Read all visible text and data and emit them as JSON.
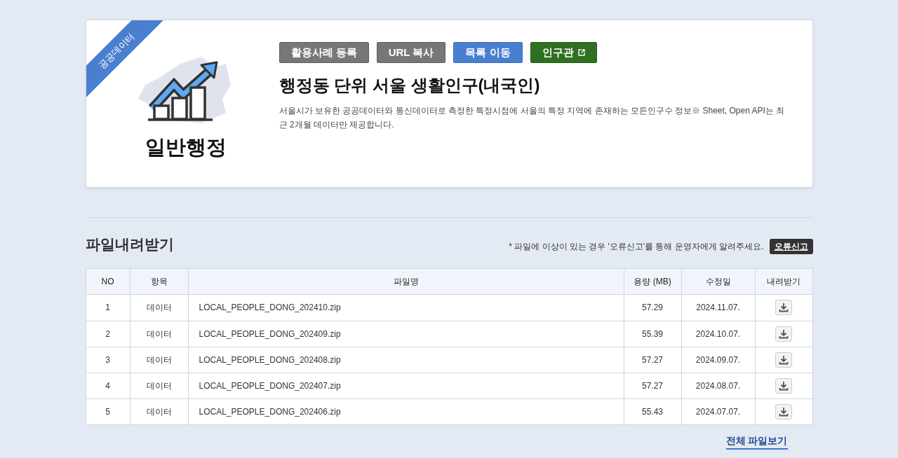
{
  "dataset": {
    "ribbon": "공공데이터",
    "category": "일반행정",
    "buttons": [
      {
        "label": "활용사례 등록",
        "kind": "gray"
      },
      {
        "label": "URL 복사",
        "kind": "gray"
      },
      {
        "label": "목록 이동",
        "kind": "blue"
      },
      {
        "label": "인구관",
        "kind": "external"
      }
    ],
    "title": "행정동 단위 서울 생활인구(내국인)",
    "description": "서울시가 보유한 공공데이터와 통신데이터로 측정한 특정시점에 서울의 특정 지역에 존재하는 모든인구수 정보※ Sheet, Open API는 최근 2개월 데이터만 제공합니다."
  },
  "downloads": {
    "title": "파일내려받기",
    "notice": "* 파일에 이상이 있는 경우 '오류신고'를 통해 운영자에게 알려주세요.",
    "report_button": "오류신고",
    "columns": [
      "NO",
      "항목",
      "파일명",
      "용량 (MB)",
      "수정일",
      "내려받기"
    ],
    "rows": [
      {
        "no": "1",
        "type": "데이터",
        "file": "LOCAL_PEOPLE_DONG_202410.zip",
        "size": "57.29",
        "date": "2024.11.07."
      },
      {
        "no": "2",
        "type": "데이터",
        "file": "LOCAL_PEOPLE_DONG_202409.zip",
        "size": "55.39",
        "date": "2024.10.07."
      },
      {
        "no": "3",
        "type": "데이터",
        "file": "LOCAL_PEOPLE_DONG_202408.zip",
        "size": "57.27",
        "date": "2024.09.07."
      },
      {
        "no": "4",
        "type": "데이터",
        "file": "LOCAL_PEOPLE_DONG_202407.zip",
        "size": "57.27",
        "date": "2024.08.07."
      },
      {
        "no": "5",
        "type": "데이터",
        "file": "LOCAL_PEOPLE_DONG_202406.zip",
        "size": "55.43",
        "date": "2024.07.07."
      }
    ],
    "all_files_link": "전체 파일보기"
  }
}
